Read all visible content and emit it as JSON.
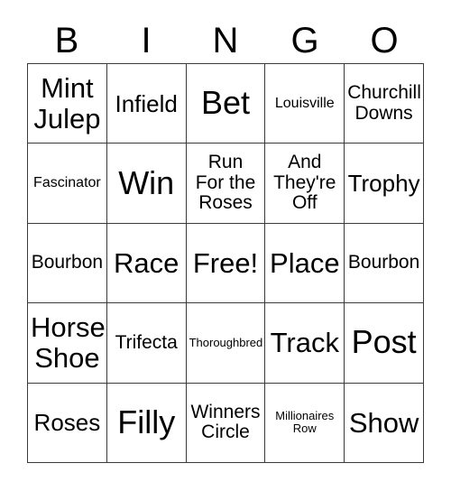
{
  "card": {
    "title": "BINGO",
    "header_letters": [
      "B",
      "I",
      "N",
      "G",
      "O"
    ],
    "free_space_label": "Free!",
    "colors": {
      "text": "#000000",
      "grid_line": "#3a3a3a",
      "background": "#ffffff"
    },
    "rows": [
      [
        {
          "text": "Mint\nJulep",
          "size": "lg"
        },
        {
          "text": "Infield",
          "size": "md"
        },
        {
          "text": "Bet",
          "size": "xl"
        },
        {
          "text": "Louisville",
          "size": "xs"
        },
        {
          "text": "Churchill\nDowns",
          "size": "sm"
        }
      ],
      [
        {
          "text": "Fascinator",
          "size": "xs"
        },
        {
          "text": "Win",
          "size": "xl"
        },
        {
          "text": "Run\nFor the\nRoses",
          "size": "sm"
        },
        {
          "text": "And\nThey're\nOff",
          "size": "sm"
        },
        {
          "text": "Trophy",
          "size": "md"
        }
      ],
      [
        {
          "text": "Bourbon",
          "size": "sm"
        },
        {
          "text": "Race",
          "size": "lg"
        },
        {
          "text": "Free!",
          "size": "lg"
        },
        {
          "text": "Place",
          "size": "lg"
        },
        {
          "text": "Bourbon",
          "size": "sm"
        }
      ],
      [
        {
          "text": "Horse\nShoe",
          "size": "lg"
        },
        {
          "text": "Trifecta",
          "size": "sm"
        },
        {
          "text": "Thoroughbred",
          "size": "xxs"
        },
        {
          "text": "Track",
          "size": "lg"
        },
        {
          "text": "Post",
          "size": "xl"
        }
      ],
      [
        {
          "text": "Roses",
          "size": "md"
        },
        {
          "text": "Filly",
          "size": "xl"
        },
        {
          "text": "Winners\nCircle",
          "size": "sm"
        },
        {
          "text": "Millionaires\nRow",
          "size": "xxs"
        },
        {
          "text": "Show",
          "size": "lg"
        }
      ]
    ]
  }
}
